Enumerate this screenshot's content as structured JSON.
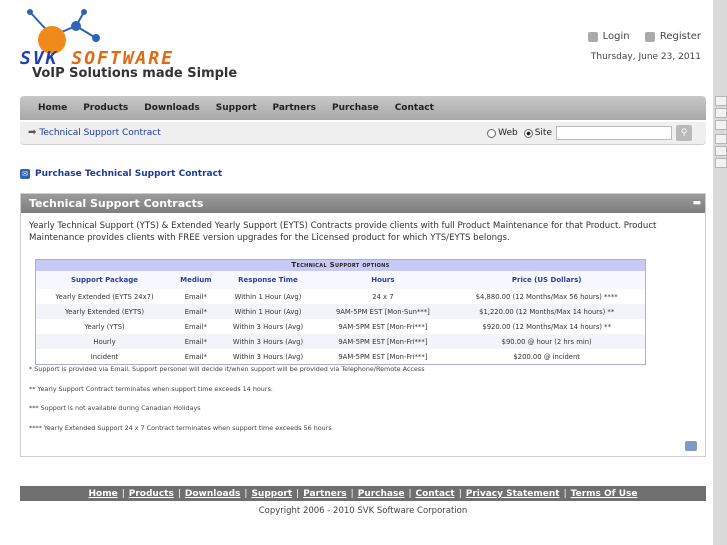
{
  "header": {
    "logo_part1": "SVK",
    "logo_part2": "SOFTWARE",
    "tagline": "VoIP Solutions made Simple",
    "login": "Login",
    "register": "Register",
    "date": "Thursday, June 23, 2011"
  },
  "nav": {
    "items": [
      "Home",
      "Products",
      "Downloads",
      "Support",
      "Partners",
      "Purchase",
      "Contact"
    ]
  },
  "subnav": {
    "breadcrumb": "Technical Support Contract",
    "radio_web": "Web",
    "radio_site": "Site",
    "selected": "Site",
    "search_value": ""
  },
  "purchase_link": "Purchase Technical Support Contract",
  "panel": {
    "title": "Technical Support Contracts",
    "intro": "Yearly Technical Support (YTS) & Extended Yearly Support (EYTS) Contracts provide clients with full Product Maintenance for that Product. Product Maintenance provides clients with FREE version upgrades for the Licensed product for which YTS/EYTS belongs.",
    "table_title": "Technical Support options",
    "columns": [
      "Support Package",
      "Medium",
      "Response Time",
      "Hours",
      "Price (US Dollars)"
    ],
    "rows": [
      [
        "Yearly Extended (EYTS 24x7)",
        "Email*",
        "Within 1 Hour (Avg)",
        "24 x 7",
        "$4,880.00 (12 Months/Max 56 hours) ****"
      ],
      [
        "Yearly Extended (EYTS)",
        "Email*",
        "Within 1 Hour (Avg)",
        "9AM-5PM EST [Mon-Sun***]",
        "$1,220.00 (12 Months/Max 14 hours) **"
      ],
      [
        "Yearly (YTS)",
        "Email*",
        "Within 3 Hours (Avg)",
        "9AM-5PM EST [Mon-Fri***]",
        "$920.00 (12 Months/Max 14 hours) **"
      ],
      [
        "Hourly",
        "Email*",
        "Within 3 Hours (Avg)",
        "9AM-5PM EST [Mon-Fri***]",
        "$90.00 @ hour (2 hrs min)"
      ],
      [
        "Incident",
        "Email*",
        "Within 3 Hours (Avg)",
        "9AM-5PM EST [Mon-Fri***]",
        "$200.00 @ incident"
      ]
    ],
    "notes": [
      "* Support is provided via Email. Support personel will decide it/when support will be provided via Telephone/Remote Access",
      "** Yearly Support Contract terminates when support time exceeds 14 hours.",
      "*** Support is not available during Canadian Holidays",
      "**** Yearly Extended Support 24 x 7 Contract terminates when support time exceeds 56 hours"
    ]
  },
  "footer": {
    "links": [
      "Home",
      "Products",
      "Downloads",
      "Support",
      "Partners",
      "Purchase",
      "Contact",
      "Privacy Statement",
      "Terms Of Use"
    ],
    "copyright": "Copyright 2006 - 2010 SVK Software Corporation"
  },
  "colors": {
    "logo_blue": "#1f3fb5",
    "logo_orange": "#e26a12",
    "link_blue": "#1c3c9c",
    "nav_gray": "#a8a8a8",
    "table_header": "#c9c9f5"
  }
}
